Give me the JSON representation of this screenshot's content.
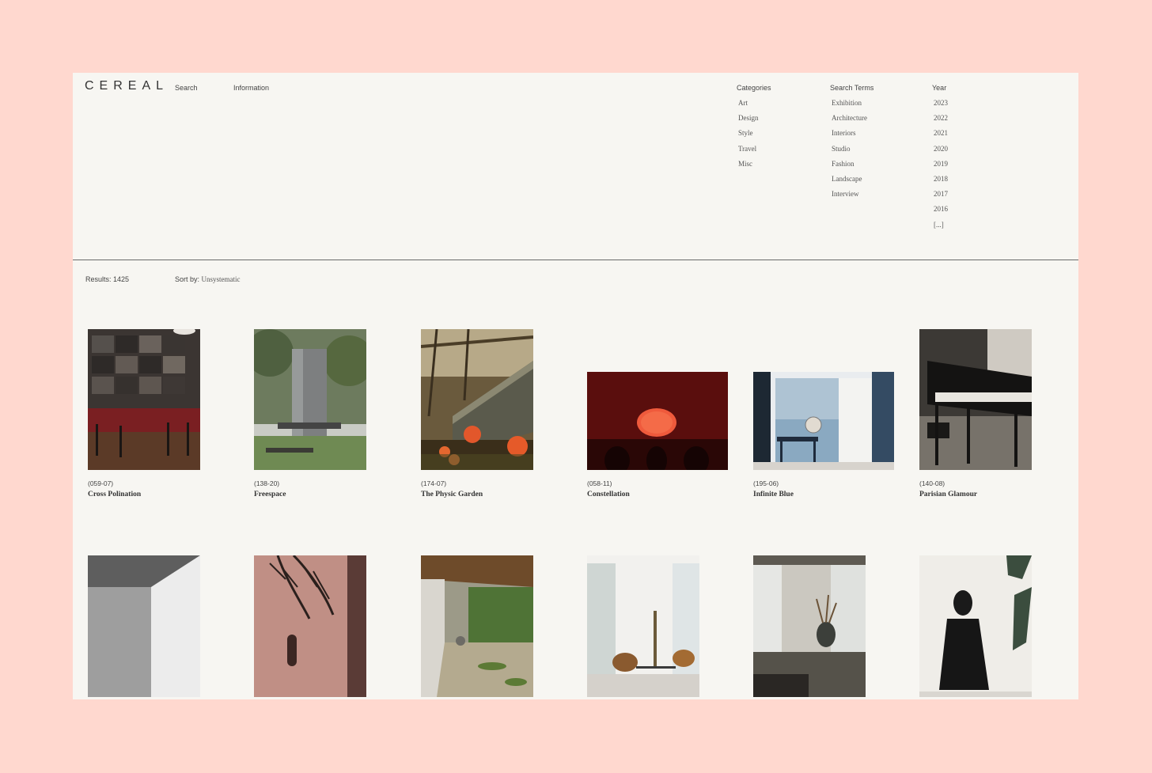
{
  "header": {
    "logo": "CEREAL",
    "nav": {
      "search": "Search",
      "information": "Information"
    }
  },
  "filters": {
    "categories": {
      "label": "Categories",
      "items": [
        "Art",
        "Design",
        "Style",
        "Travel",
        "Misc"
      ]
    },
    "search_terms": {
      "label": "Search Terms",
      "items": [
        "Exhibition",
        "Architecture",
        "Interiors",
        "Studio",
        "Fashion",
        "Landscape",
        "Interview"
      ]
    },
    "year": {
      "label": "Year",
      "items": [
        "2023",
        "2022",
        "2021",
        "2020",
        "2019",
        "2018",
        "2017",
        "2016",
        "[...]"
      ]
    }
  },
  "toolbar": {
    "results_label": "Results:",
    "results_count": "1425",
    "sort_label": "Sort by:",
    "sort_value": "Unsystematic"
  },
  "grid": {
    "row1": [
      {
        "code": "(059-07)",
        "title": "Cross Polination"
      },
      {
        "code": "(138-20)",
        "title": "Freespace"
      },
      {
        "code": "(174-07)",
        "title": "The Physic Garden"
      },
      {
        "code": "(058-11)",
        "title": "Constellation"
      },
      {
        "code": "(195-06)",
        "title": "Infinite Blue"
      },
      {
        "code": "(140-08)",
        "title": "Parisian Glamour"
      }
    ]
  },
  "colors": {
    "outer_background": "#ffd8cf",
    "page_background": "#f7f6f2",
    "divider": "#6a6a6a"
  }
}
